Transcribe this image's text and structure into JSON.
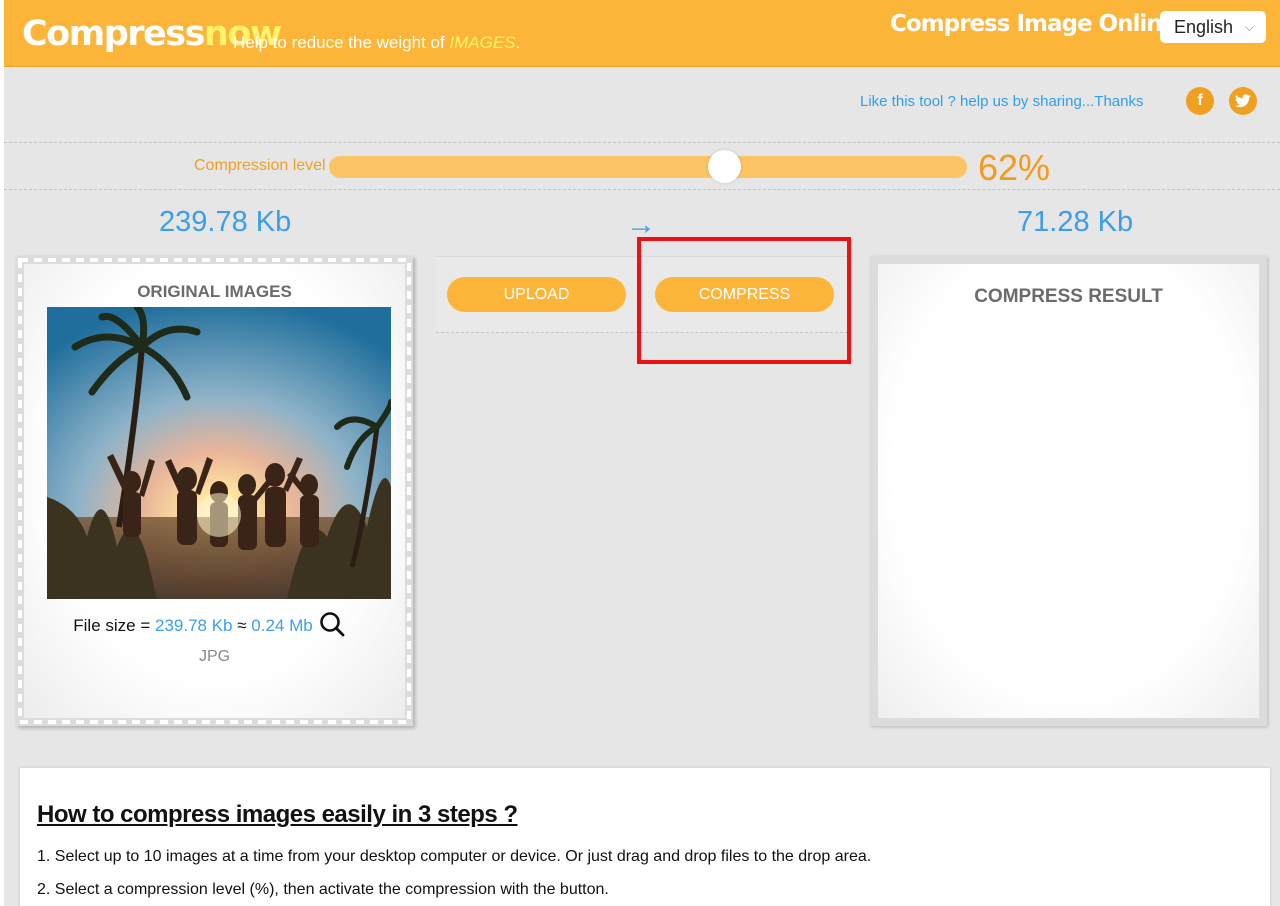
{
  "header": {
    "logo_part1": "Compress",
    "logo_part2": "now",
    "tagline_prefix": "Help to reduce the weight of ",
    "tagline_highlight": "IMAGES",
    "tagline_suffix": ".",
    "title": "Compress Image Online",
    "language": "English"
  },
  "share": {
    "text": "Like this tool ? help us by sharing...Thanks",
    "facebook_glyph": "f"
  },
  "compression": {
    "label": "Compression level",
    "value_text": "62%",
    "level": 0.62
  },
  "sizes": {
    "original": "239.78 Kb",
    "arrow": "→",
    "result": "71.28 Kb"
  },
  "original_panel": {
    "title": "ORIGINAL IMAGES",
    "file_size_label": "File size = ",
    "file_size_kb": "239.78 Kb",
    "approx": " ≈ ",
    "file_size_mb": "0.24 Mb",
    "file_type": "JPG"
  },
  "buttons": {
    "upload": "UPLOAD",
    "compress": "COMPRESS"
  },
  "result_panel": {
    "title": "COMPRESS RESULT"
  },
  "howto": {
    "title": "How to compress images easily in 3 steps ?",
    "steps": [
      "1. Select up to 10 images at a time from your desktop computer or device. Or just drag and drop files to the drop area.",
      "2. Select a compression level (%), then activate the compression with the button."
    ]
  },
  "colors": {
    "brand_orange": "#fdb539",
    "accent_blue": "#3a9fe8",
    "highlight_red": "#ee1111"
  }
}
